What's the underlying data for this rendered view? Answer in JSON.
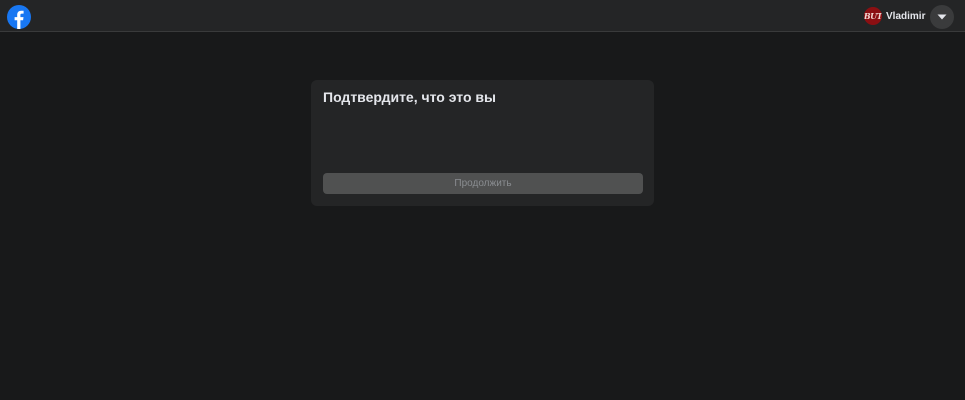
{
  "header": {
    "logo_icon": "facebook-logo-icon",
    "brand_color": "#1877f2",
    "user": {
      "name": "Vladimir",
      "avatar_text": "BUT",
      "avatar_color": "#8b0f12"
    },
    "menu_icon": "caret-down-icon"
  },
  "main": {
    "card": {
      "title": "Подтвердите, что это вы",
      "continue_label": "Продолжить",
      "continue_disabled": true
    }
  }
}
